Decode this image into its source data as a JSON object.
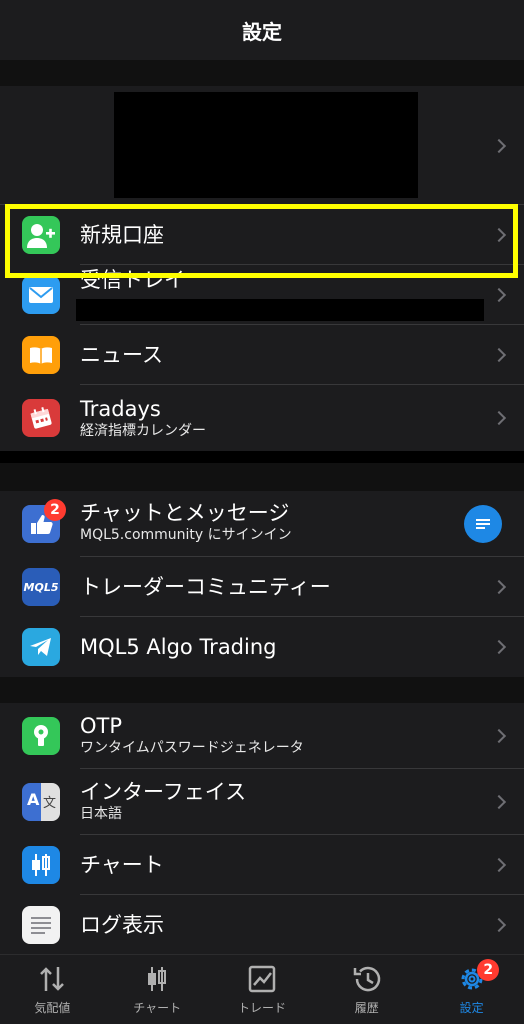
{
  "header": {
    "title": "設定"
  },
  "group1": {
    "new_account": {
      "label": "新規口座"
    },
    "mailbox": {
      "label": "受信トレイ"
    },
    "news": {
      "label": "ニュース"
    },
    "tradays": {
      "label": "Tradays",
      "sub": "経済指標カレンダー"
    }
  },
  "group2": {
    "chat": {
      "label": "チャットとメッセージ",
      "sub": "MQL5.community にサインイン",
      "badge": "2"
    },
    "community": {
      "label": "トレーダーコミュニティー",
      "logo": "MQL5"
    },
    "algo": {
      "label": "MQL5 Algo Trading"
    }
  },
  "group3": {
    "otp": {
      "label": "OTP",
      "sub": "ワンタイムパスワードジェネレータ"
    },
    "interface": {
      "label": "インターフェイス",
      "sub": "日本語"
    },
    "charts": {
      "label": "チャート"
    },
    "journal": {
      "label": "ログ表示"
    }
  },
  "tabbar": {
    "tabs": [
      {
        "label": "気配値",
        "icon": "quotes-icon"
      },
      {
        "label": "チャート",
        "icon": "chart-icon"
      },
      {
        "label": "トレード",
        "icon": "trade-icon"
      },
      {
        "label": "履歴",
        "icon": "history-icon"
      },
      {
        "label": "設定",
        "icon": "settings-icon",
        "badge": "2",
        "active": true
      }
    ]
  },
  "colors": {
    "accent": "#1e88e5",
    "highlight": "#ffff00",
    "badge": "#ff3b30"
  }
}
